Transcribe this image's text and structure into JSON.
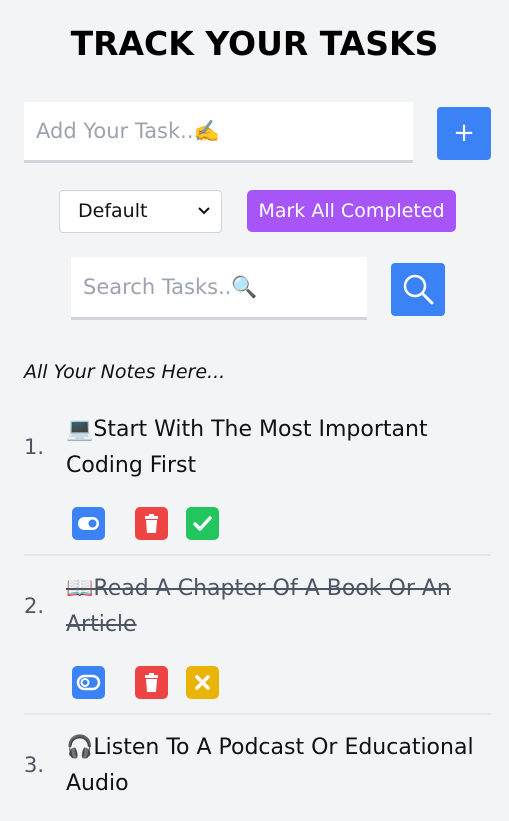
{
  "header": {
    "title": "TRACK YOUR TASKS"
  },
  "add": {
    "placeholder": "Add Your Task..✍️",
    "button_label": "+"
  },
  "filter": {
    "selected": "Default",
    "chevron": "⌄"
  },
  "mark_all_label": "Mark All Completed",
  "search": {
    "placeholder": "Search Tasks..🔍"
  },
  "notes_label": "All Your Notes Here...",
  "tasks": [
    {
      "num": "1.",
      "text": "💻Start With The Most Important Coding First",
      "completed": false
    },
    {
      "num": "2.",
      "text": "📖Read A Chapter Of A Book Or An Article",
      "completed": true
    },
    {
      "num": "3.",
      "text": "🎧Listen To A Podcast Or Educational Audio",
      "completed": false
    }
  ],
  "colors": {
    "primary": "#3b82f6",
    "purple": "#a855f7",
    "delete": "#ef4444",
    "complete": "#22c55e",
    "undo": "#eab308",
    "background": "#f3f4f6"
  }
}
